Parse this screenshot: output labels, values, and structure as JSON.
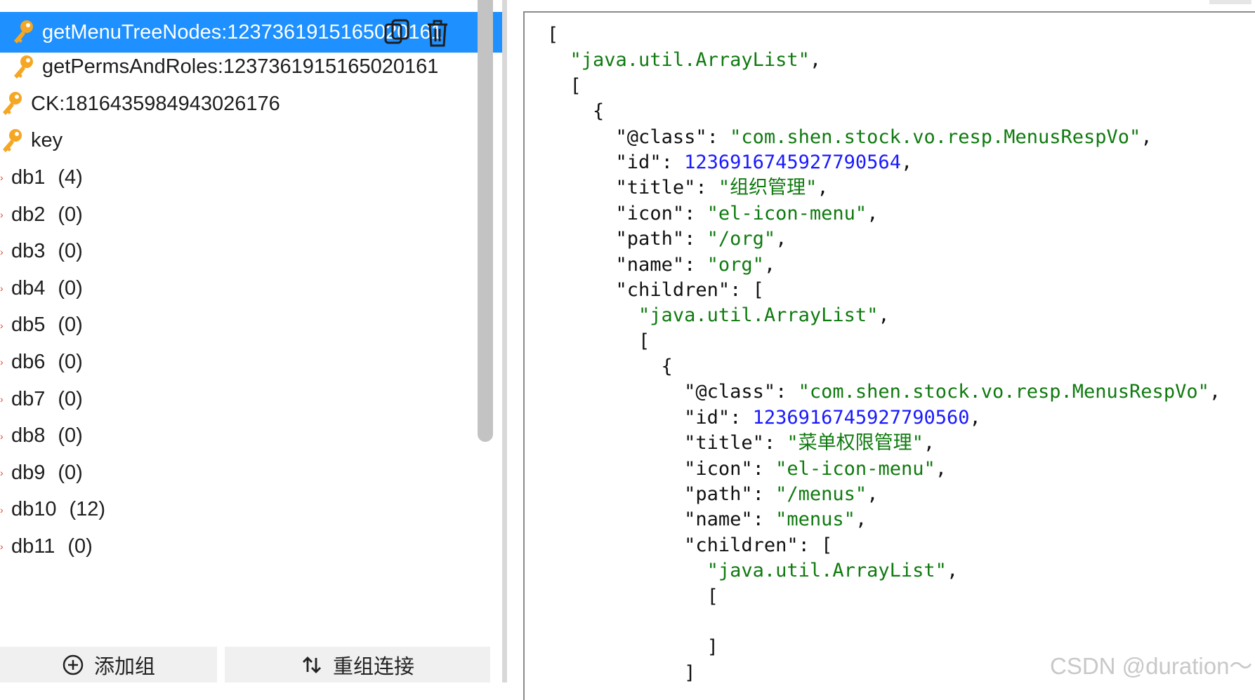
{
  "tree": {
    "keys": [
      {
        "label": "getMenuTreeNodes:1237361915165020161",
        "selected": true
      },
      {
        "label": "getPermsAndRoles:1237361915165020161",
        "selected": false
      },
      {
        "label": "CK:1816435984943026176",
        "selected": false
      },
      {
        "label": "key",
        "selected": false
      }
    ],
    "databases": [
      {
        "name": "db1",
        "count": "(4)"
      },
      {
        "name": "db2",
        "count": "(0)"
      },
      {
        "name": "db3",
        "count": "(0)"
      },
      {
        "name": "db4",
        "count": "(0)"
      },
      {
        "name": "db5",
        "count": "(0)"
      },
      {
        "name": "db6",
        "count": "(0)"
      },
      {
        "name": "db7",
        "count": "(0)"
      },
      {
        "name": "db8",
        "count": "(0)"
      },
      {
        "name": "db9",
        "count": "(0)"
      },
      {
        "name": "db10",
        "count": "(12)"
      },
      {
        "name": "db11",
        "count": "(0)"
      }
    ],
    "key_icon_color": "#f5a623",
    "selected_color": "#1e90ff"
  },
  "footer": {
    "add_group_label": "添加组",
    "reconnect_label": "重组连接"
  },
  "json_view": {
    "lines": [
      [
        [
          "p",
          "["
        ]
      ],
      [
        [
          "p",
          "  "
        ],
        [
          "s",
          "\"java.util.ArrayList\""
        ],
        [
          "p",
          ","
        ]
      ],
      [
        [
          "p",
          "  ["
        ]
      ],
      [
        [
          "p",
          "    {"
        ]
      ],
      [
        [
          "p",
          "      "
        ],
        [
          "k",
          "\"@class\""
        ],
        [
          "p",
          ": "
        ],
        [
          "s",
          "\"com.shen.stock.vo.resp.MenusRespVo\""
        ],
        [
          "p",
          ","
        ]
      ],
      [
        [
          "p",
          "      "
        ],
        [
          "k",
          "\"id\""
        ],
        [
          "p",
          ": "
        ],
        [
          "n",
          "1236916745927790564"
        ],
        [
          "p",
          ","
        ]
      ],
      [
        [
          "p",
          "      "
        ],
        [
          "k",
          "\"title\""
        ],
        [
          "p",
          ": "
        ],
        [
          "s",
          "\"组织管理\""
        ],
        [
          "p",
          ","
        ]
      ],
      [
        [
          "p",
          "      "
        ],
        [
          "k",
          "\"icon\""
        ],
        [
          "p",
          ": "
        ],
        [
          "s",
          "\"el-icon-menu\""
        ],
        [
          "p",
          ","
        ]
      ],
      [
        [
          "p",
          "      "
        ],
        [
          "k",
          "\"path\""
        ],
        [
          "p",
          ": "
        ],
        [
          "s",
          "\"/org\""
        ],
        [
          "p",
          ","
        ]
      ],
      [
        [
          "p",
          "      "
        ],
        [
          "k",
          "\"name\""
        ],
        [
          "p",
          ": "
        ],
        [
          "s",
          "\"org\""
        ],
        [
          "p",
          ","
        ]
      ],
      [
        [
          "p",
          "      "
        ],
        [
          "k",
          "\"children\""
        ],
        [
          "p",
          ": ["
        ]
      ],
      [
        [
          "p",
          "        "
        ],
        [
          "s",
          "\"java.util.ArrayList\""
        ],
        [
          "p",
          ","
        ]
      ],
      [
        [
          "p",
          "        ["
        ]
      ],
      [
        [
          "p",
          "          {"
        ]
      ],
      [
        [
          "p",
          "            "
        ],
        [
          "k",
          "\"@class\""
        ],
        [
          "p",
          ": "
        ],
        [
          "s",
          "\"com.shen.stock.vo.resp.MenusRespVo\""
        ],
        [
          "p",
          ","
        ]
      ],
      [
        [
          "p",
          "            "
        ],
        [
          "k",
          "\"id\""
        ],
        [
          "p",
          ": "
        ],
        [
          "n",
          "1236916745927790560"
        ],
        [
          "p",
          ","
        ]
      ],
      [
        [
          "p",
          "            "
        ],
        [
          "k",
          "\"title\""
        ],
        [
          "p",
          ": "
        ],
        [
          "s",
          "\"菜单权限管理\""
        ],
        [
          "p",
          ","
        ]
      ],
      [
        [
          "p",
          "            "
        ],
        [
          "k",
          "\"icon\""
        ],
        [
          "p",
          ": "
        ],
        [
          "s",
          "\"el-icon-menu\""
        ],
        [
          "p",
          ","
        ]
      ],
      [
        [
          "p",
          "            "
        ],
        [
          "k",
          "\"path\""
        ],
        [
          "p",
          ": "
        ],
        [
          "s",
          "\"/menus\""
        ],
        [
          "p",
          ","
        ]
      ],
      [
        [
          "p",
          "            "
        ],
        [
          "k",
          "\"name\""
        ],
        [
          "p",
          ": "
        ],
        [
          "s",
          "\"menus\""
        ],
        [
          "p",
          ","
        ]
      ],
      [
        [
          "p",
          "            "
        ],
        [
          "k",
          "\"children\""
        ],
        [
          "p",
          ": ["
        ]
      ],
      [
        [
          "p",
          "              "
        ],
        [
          "s",
          "\"java.util.ArrayList\""
        ],
        [
          "p",
          ","
        ]
      ],
      [
        [
          "p",
          "              ["
        ]
      ],
      [
        [
          "p",
          ""
        ]
      ],
      [
        [
          "p",
          "              ]"
        ]
      ],
      [
        [
          "p",
          "            ]"
        ]
      ]
    ],
    "colors": {
      "key": "#111111",
      "string": "#0f7a0f",
      "number": "#1919ff"
    }
  },
  "watermark": "CSDN @duration～"
}
